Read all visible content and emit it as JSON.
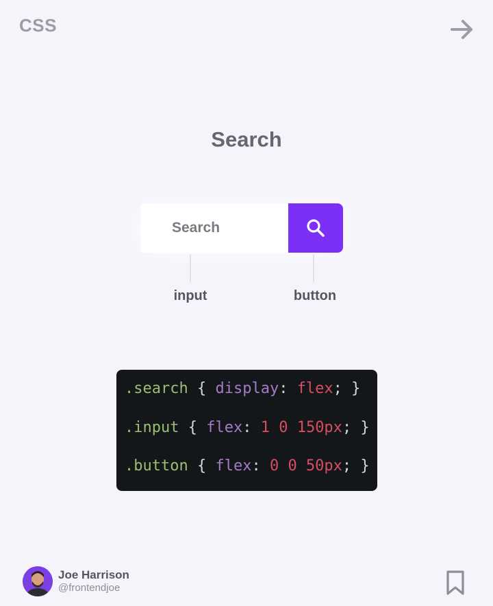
{
  "header": {
    "topic_tag": "CSS",
    "next_icon": "arrow-right-icon"
  },
  "card": {
    "title": "Search"
  },
  "demo": {
    "input_placeholder": "Search",
    "button_icon": "search-icon",
    "button_color": "#7b2ff7",
    "input_label": "input",
    "button_label": "button"
  },
  "code": {
    "lines": [
      [
        {
          "t": ".search",
          "c": "sel"
        },
        {
          "t": " { ",
          "c": "punc"
        },
        {
          "t": "display",
          "c": "prop"
        },
        {
          "t": ": ",
          "c": "punc"
        },
        {
          "t": "flex",
          "c": "val"
        },
        {
          "t": "; }",
          "c": "punc"
        }
      ],
      [
        {
          "t": ".input",
          "c": "sel"
        },
        {
          "t": " { ",
          "c": "punc"
        },
        {
          "t": "flex",
          "c": "prop"
        },
        {
          "t": ": ",
          "c": "punc"
        },
        {
          "t": "1 0 150px",
          "c": "val"
        },
        {
          "t": "; }",
          "c": "punc"
        }
      ],
      [
        {
          "t": ".button",
          "c": "sel"
        },
        {
          "t": " { ",
          "c": "punc"
        },
        {
          "t": "flex",
          "c": "prop"
        },
        {
          "t": ": ",
          "c": "punc"
        },
        {
          "t": "0 0 50px",
          "c": "val"
        },
        {
          "t": "; }",
          "c": "punc"
        }
      ]
    ]
  },
  "author": {
    "name": "Joe Harrison",
    "handle": "@frontendjoe",
    "avatar_icon": "avatar"
  },
  "footer": {
    "bookmark_icon": "bookmark-icon"
  },
  "colors": {
    "background": "#f5f4fb",
    "accent": "#7b2ff7",
    "code_background": "#141719"
  }
}
